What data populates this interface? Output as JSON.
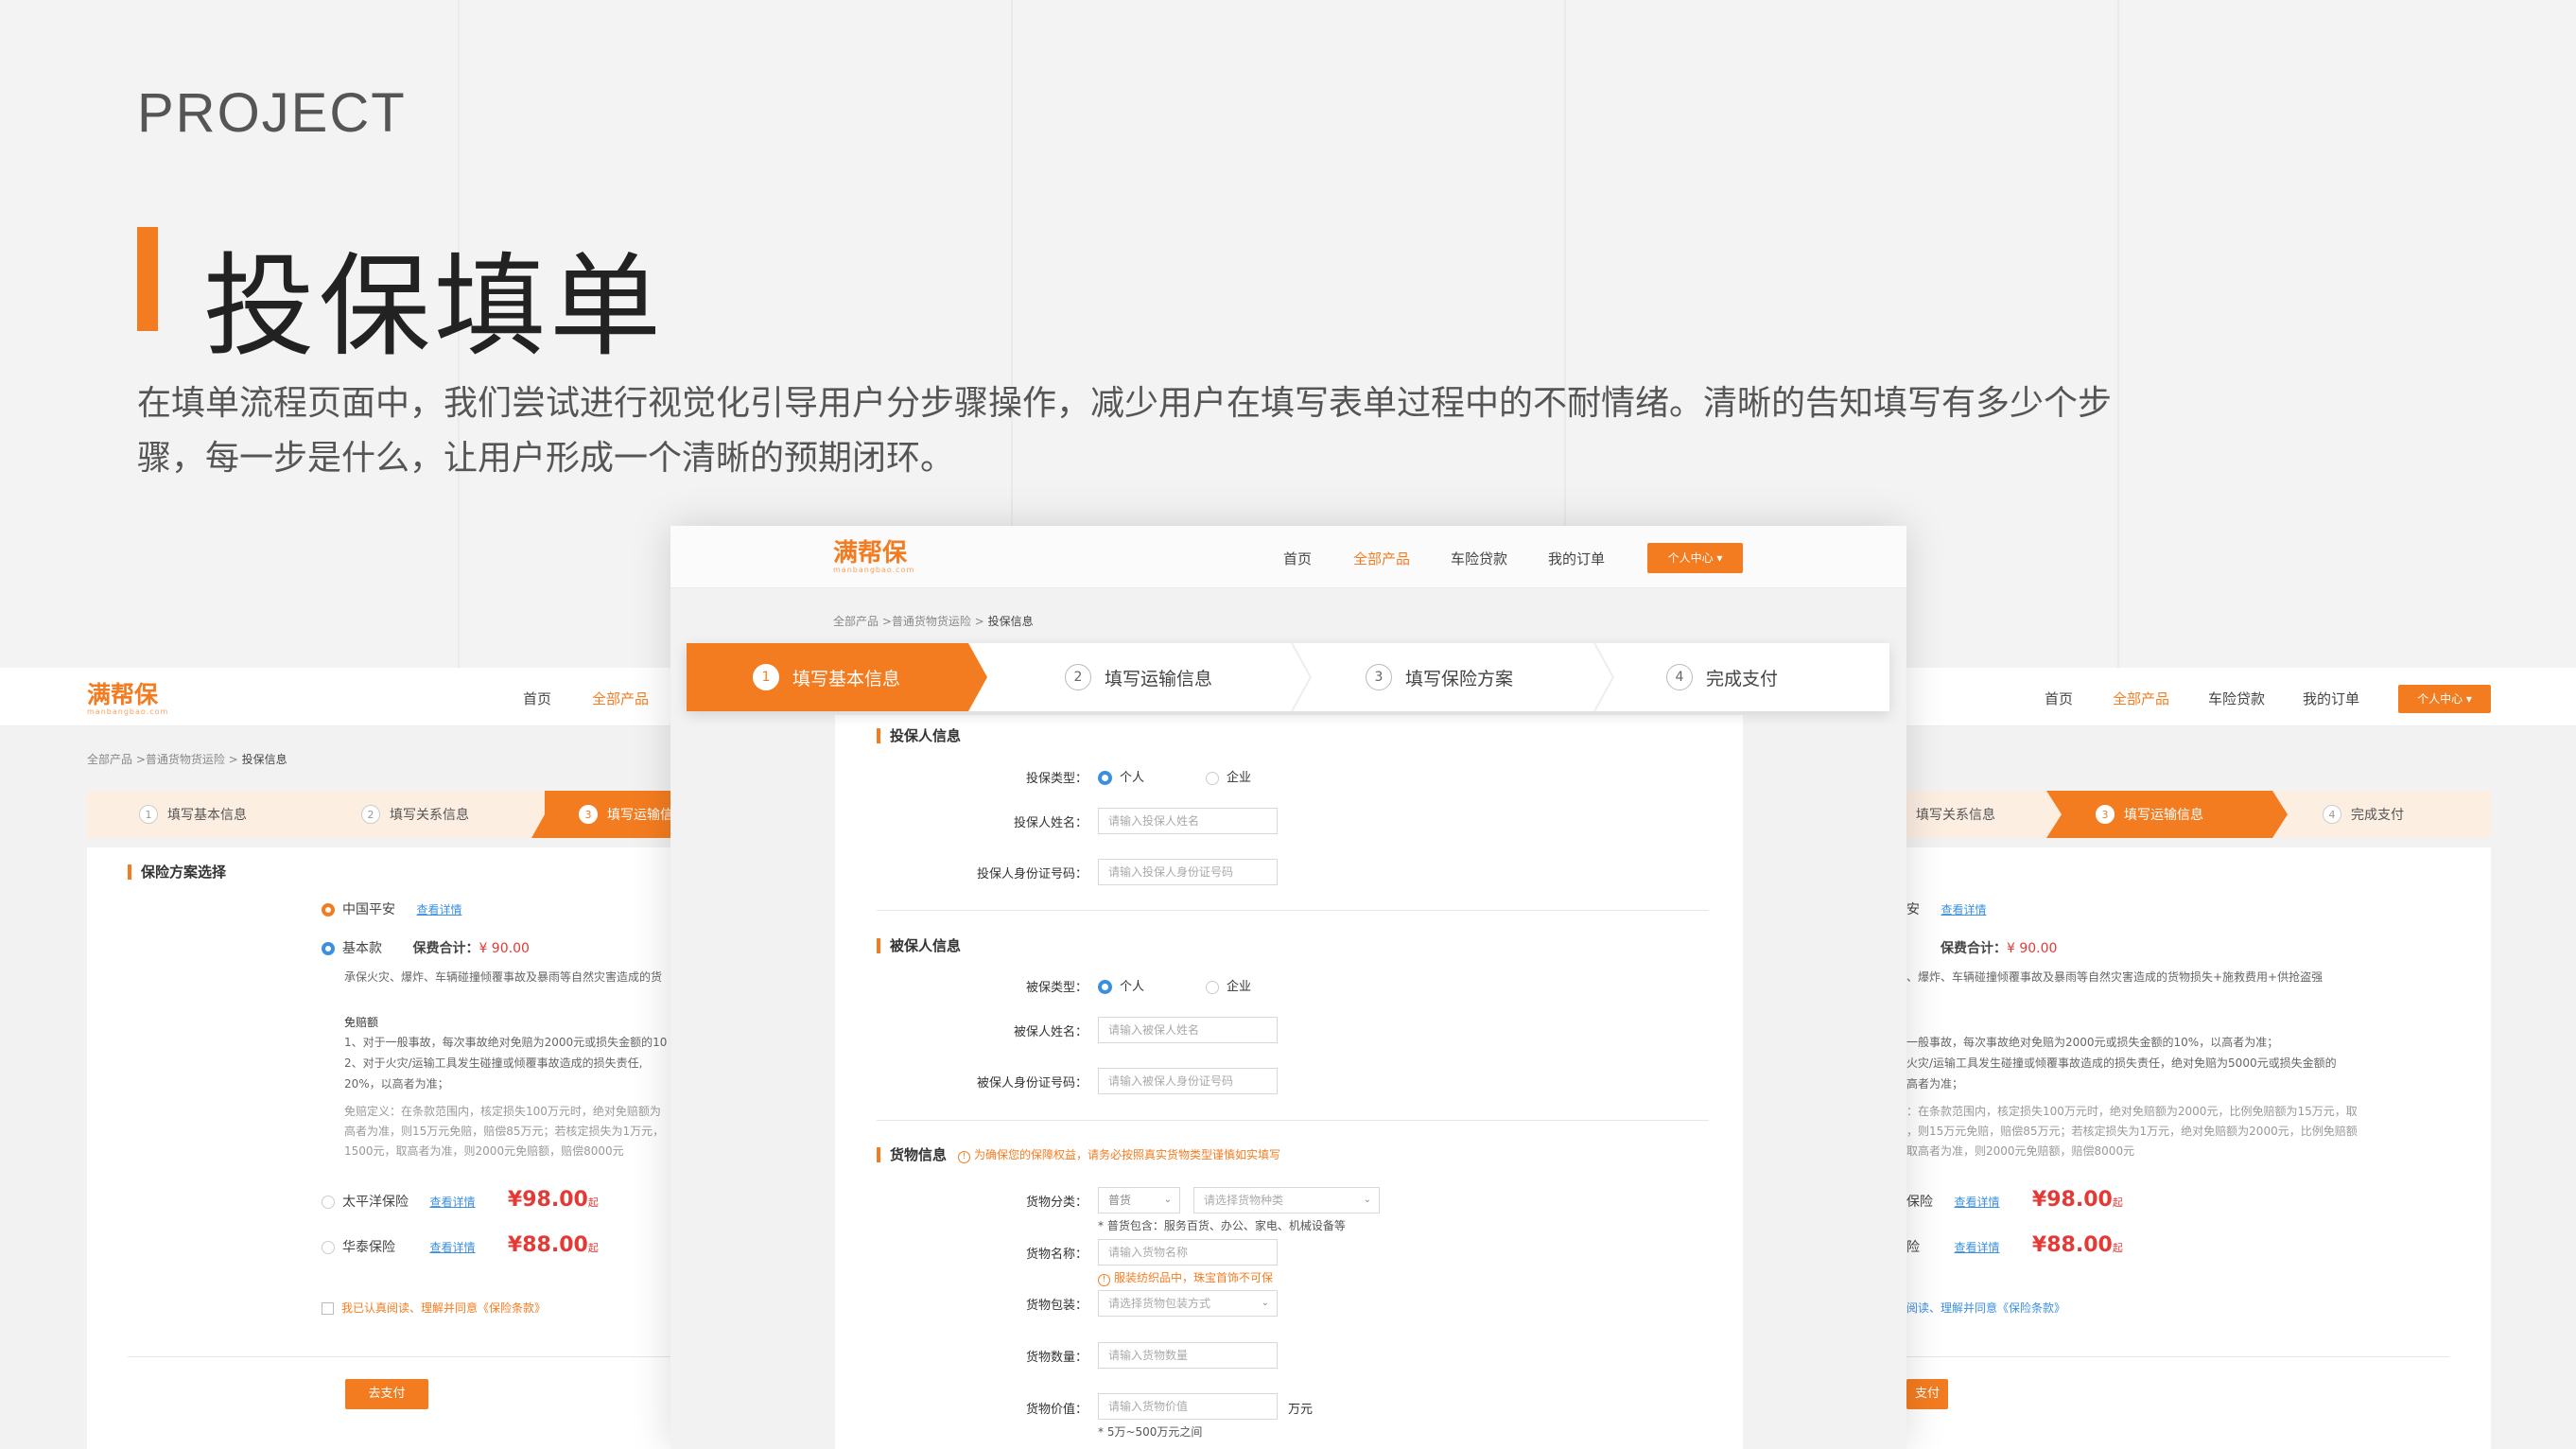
{
  "page": {
    "eyebrow": "PROJECT",
    "title": "投保填单",
    "description": "在填单流程页面中，我们尝试进行视觉化引导用户分步骤操作，减少用户在填写表单过程中的不耐情绪。清晰的告知填写有多少个步骤，每一步是什么，让用户形成一个清晰的预期闭环。"
  },
  "app": {
    "logo": "满帮保",
    "logo_sub": "manbangbao.com",
    "nav": [
      "首页",
      "全部产品",
      "车险贷款",
      "我的订单"
    ],
    "user_button": "个人中心",
    "breadcrumb_prefix": "全部产品 >普通货物货运险 > ",
    "breadcrumb_current": "投保信息",
    "accent": "#f47c20"
  },
  "center": {
    "steps": [
      {
        "num": "1",
        "label": "填写基本信息"
      },
      {
        "num": "2",
        "label": "填写运输信息"
      },
      {
        "num": "3",
        "label": "填写保险方案"
      },
      {
        "num": "4",
        "label": "完成支付"
      }
    ],
    "applicant": {
      "title": "投保人信息",
      "type_label": "投保类型：",
      "opt_personal": "个人",
      "opt_company": "企业",
      "name_label": "投保人姓名：",
      "name_placeholder": "请输入投保人姓名",
      "id_label": "投保人身份证号码：",
      "id_placeholder": "请输入投保人身份证号码"
    },
    "insured": {
      "title": "被保人信息",
      "type_label": "被保类型：",
      "opt_personal": "个人",
      "opt_company": "企业",
      "name_label": "被保人姓名：",
      "name_placeholder": "请输入被保人姓名",
      "id_label": "被保人身份证号码：",
      "id_placeholder": "请输入被保人身份证号码"
    },
    "cargo": {
      "title": "货物信息",
      "notice": "为确保您的保障权益，请务必按照真实货物类型谨慎如实填写",
      "category_label": "货物分类：",
      "category_value": "普货",
      "category_placeholder": "请选择货物种类",
      "category_hint": "* 普货包含：服务百货、办公、家电、机械设备等",
      "name_label": "货物名称：",
      "name_placeholder": "请输入货物名称",
      "name_warning": "服装纺织品中，珠宝首饰不可保",
      "pack_label": "货物包装：",
      "pack_placeholder": "请选择货物包装方式",
      "qty_label": "货物数量：",
      "qty_placeholder": "请输入货物数量",
      "value_label": "货物价值：",
      "value_placeholder": "请输入货物价值",
      "value_unit": "万元",
      "value_hint": "* 5万~500万元之间"
    }
  },
  "left": {
    "steps": [
      {
        "num": "1",
        "label": "填写基本信息"
      },
      {
        "num": "2",
        "label": "填写关系信息"
      },
      {
        "num": "3",
        "label": "填写运输信息"
      }
    ],
    "section_title": "保险方案选择",
    "insurer1": "中国平安",
    "detail_link": "查看详情",
    "plan": "基本款",
    "premium_label": "保费合计：",
    "premium_value": "¥ 90.00",
    "coverage": "承保火灾、爆炸、车辆碰撞倾覆事故及暴雨等自然灾害造成的货",
    "deductible_title": "免赔额",
    "deductible_1": "1、对于一般事故，每次事故绝对免赔为2000元或损失金额的10",
    "deductible_2a": "2、对于火灾/运输工具发生碰撞或倾覆事故造成的损失责任,",
    "deductible_2b": "20%，以高者为准；",
    "def_1": "免赔定义：在条款范围内，核定损失100万元时，绝对免赔额为",
    "def_2": "高者为准，则15万元免赔，赔偿85万元；若核定损失为1万元，",
    "def_3": "1500元，取高者为准，则2000元免赔额，赔偿8000元",
    "insurer2": "太平洋保险",
    "price2": "¥98.00",
    "insurer3": "华泰保险",
    "price3": "¥88.00",
    "price_suffix": "起",
    "agree": "我已认真阅读、理解并同意《保险条款》",
    "pay_button": "去支付"
  },
  "right": {
    "steps": [
      {
        "num": "",
        "label": "填写关系信息"
      },
      {
        "num": "3",
        "label": "填写运输信息"
      },
      {
        "num": "4",
        "label": "完成支付"
      }
    ],
    "insurer1": "安",
    "detail_link": "查看详情",
    "premium_label": "保费合计：",
    "premium_value": "¥ 90.00",
    "coverage": "、爆炸、车辆碰撞倾覆事故及暴雨等自然灾害造成的货物损失+施救费用+供抢盗强",
    "ded_1": "一般事故，每次事故绝对免赔为2000元或损失金额的10%，以高者为准；",
    "ded_2": "火灾/运输工具发生碰撞或倾覆事故造成的损失责任，绝对免赔为5000元或损失金额的",
    "ded_3": "高者为准；",
    "def_1": "：在条款范围内，核定损失100万元时，绝对免赔额为2000元，比例免赔额为15万元，取",
    "def_2": "，则15万元免赔，赔偿85万元；若核定损失为1万元，绝对免赔额为2000元，比例免赔额",
    "def_3": "取高者为准，则2000元免赔额，赔偿8000元",
    "insurer2": "保险",
    "price2": "¥98.00",
    "insurer3": "险",
    "price3": "¥88.00",
    "price_suffix": "起",
    "agree": "阅读、理解并同意《保险条款》",
    "pay_button": "支付"
  }
}
